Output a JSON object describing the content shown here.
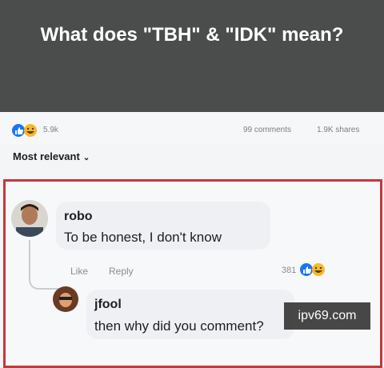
{
  "header": {
    "title": "What does \"TBH\" & \"IDK\" mean?"
  },
  "stats": {
    "reactions": "5.9k",
    "comments": "99 comments",
    "shares": "1.9K shares"
  },
  "sort": {
    "label": "Most relevant"
  },
  "comment": {
    "author": "robo",
    "text": "To be honest, I don't know",
    "like_label": "Like",
    "reply_label": "Reply",
    "reaction_count": "381"
  },
  "reply": {
    "author": "jfool",
    "text": "then why did you comment?"
  },
  "watermark": "ipv69.com",
  "colors": {
    "header_bg": "#4b4d4d",
    "highlight_border": "#c4383b",
    "like_blue": "#1877f2",
    "haha_yellow": "#f7b928"
  },
  "icons": {
    "like": "like-icon",
    "haha": "haha-icon",
    "chevron": "chevron-down-icon"
  }
}
